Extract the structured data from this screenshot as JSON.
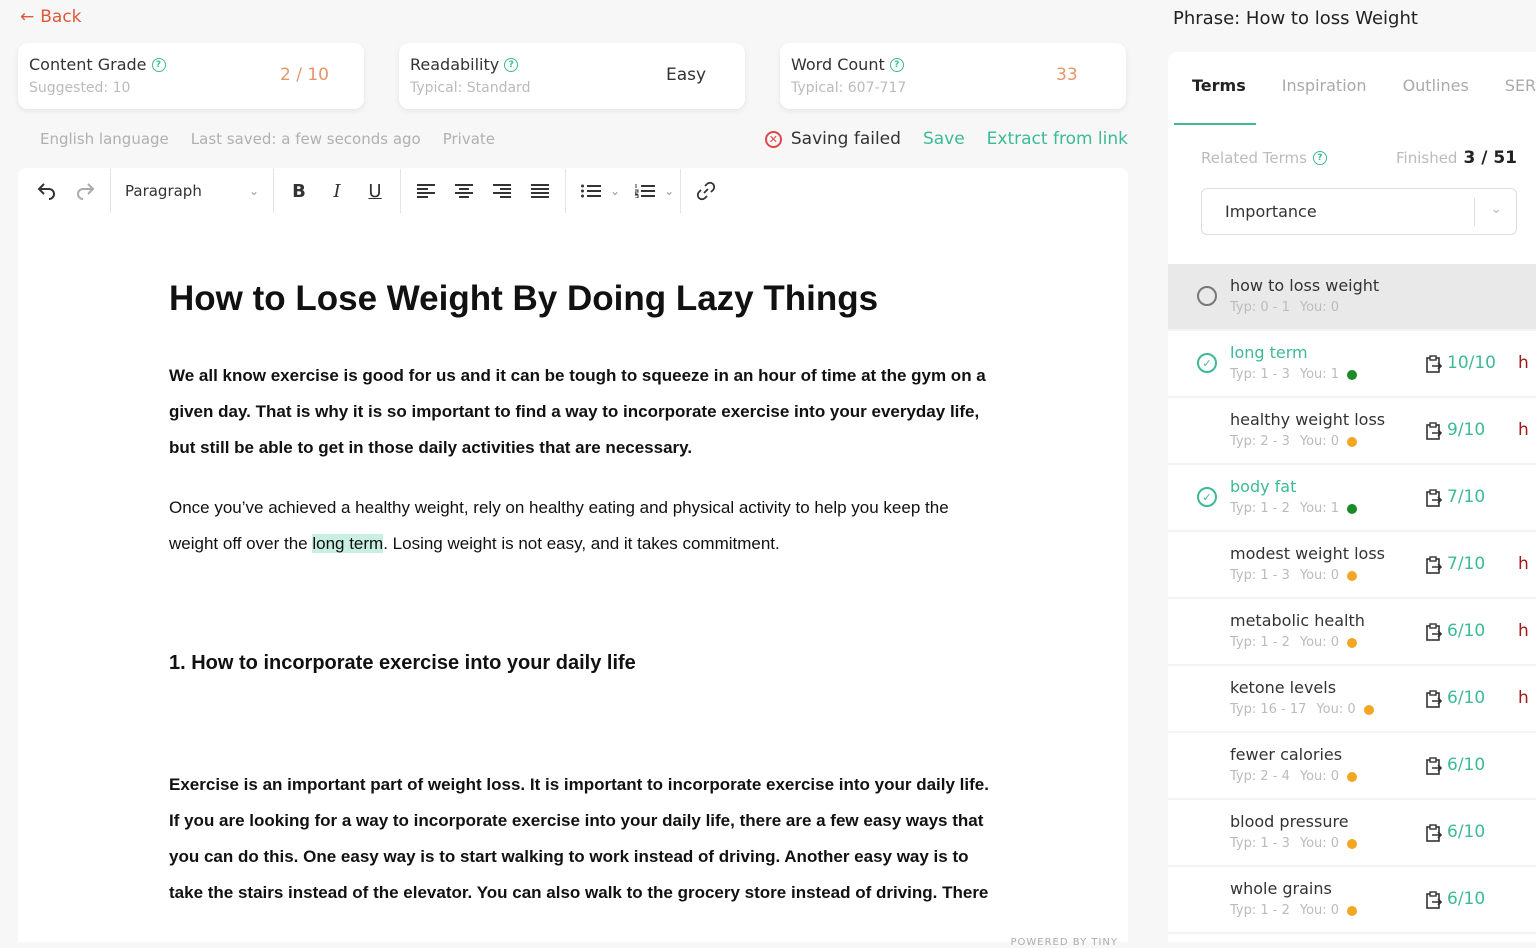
{
  "nav": {
    "back_label": "Back"
  },
  "cards": [
    {
      "title": "Content Grade",
      "sub": "Suggested: 10",
      "value": "2 / 10",
      "value_color": "#e5956a"
    },
    {
      "title": "Readability",
      "sub": "Typical: Standard",
      "value": "Easy",
      "value_color": "#333333"
    },
    {
      "title": "Word Count",
      "sub": "Typical: 607-717",
      "value": "33",
      "value_color": "#e5956a"
    }
  ],
  "meta": {
    "language": "English language",
    "last_saved": "Last saved: a few seconds ago",
    "visibility": "Private"
  },
  "save_status": {
    "status": "Saving failed",
    "save_label": "Save",
    "extract_label": "Extract from link"
  },
  "toolbar": {
    "block_format": "Paragraph",
    "icons": [
      "undo-icon",
      "redo-icon",
      "bold-icon",
      "italic-icon",
      "underline-icon",
      "align-left-icon",
      "align-center-icon",
      "align-right-icon",
      "align-justify-icon",
      "bullet-list-icon",
      "numbered-list-icon",
      "link-icon"
    ]
  },
  "document": {
    "title": "How to Lose Weight By Doing Lazy Things",
    "p1": "We all know exercise is good for us and it can be tough to squeeze in an hour of time at the gym on a given day. That is why it is so important to find a way to incorporate exercise into your everyday life, but still be able to get in those daily activities that are necessary.",
    "p2_before": "Once you’ve achieved a healthy weight, rely on healthy eating and physical activity to help you keep the weight off over the ",
    "p2_highlight": "long term",
    "p2_after": ". Losing weight is not easy, and it takes commitment.",
    "h2": "1. How to incorporate exercise into your daily life",
    "p3": "Exercise is an important part of weight loss. It is important to incorporate exercise into your daily life. If you are looking for a way to incorporate exercise into your daily life, there are a few easy ways that you can do this. One easy way is to start walking to work instead of driving. Another easy way is to take the stairs instead of the elevator. You can also walk to the grocery store instead of driving. There are many easy ways to incorporate exercise into your",
    "powered_by": "POWERED BY TINY"
  },
  "sidebar": {
    "phrase": "Phrase: How to loss Weight",
    "tabs": [
      "Terms",
      "Inspiration",
      "Outlines",
      "SERP"
    ],
    "active_tab": "Terms",
    "related_label": "Related Terms",
    "finished_label": "Finished",
    "finished_value": "3 / 51",
    "sort_value": "Importance",
    "terms": [
      {
        "name": "how to loss weight",
        "typ": "Typ: 0 - 1",
        "you": "You: 0",
        "status": "empty",
        "dot": "",
        "score": "",
        "h": ""
      },
      {
        "name": "long term",
        "typ": "Typ: 1 - 3",
        "you": "You: 1",
        "status": "done",
        "dot": "#1a8a2a",
        "score": "10/10",
        "h": "h"
      },
      {
        "name": "healthy weight loss",
        "typ": "Typ: 2 - 3",
        "you": "You: 0",
        "status": "none",
        "dot": "#f2a623",
        "score": "9/10",
        "h": "h"
      },
      {
        "name": "body fat",
        "typ": "Typ: 1 - 2",
        "you": "You: 1",
        "status": "done",
        "dot": "#1a8a2a",
        "score": "7/10",
        "h": ""
      },
      {
        "name": "modest weight loss",
        "typ": "Typ: 1 - 3",
        "you": "You: 0",
        "status": "none",
        "dot": "#f2a623",
        "score": "7/10",
        "h": "h"
      },
      {
        "name": "metabolic health",
        "typ": "Typ: 1 - 2",
        "you": "You: 0",
        "status": "none",
        "dot": "#f2a623",
        "score": "6/10",
        "h": "h"
      },
      {
        "name": "ketone levels",
        "typ": "Typ: 16 - 17",
        "you": "You: 0",
        "status": "none",
        "dot": "#f2a623",
        "score": "6/10",
        "h": "h"
      },
      {
        "name": "fewer calories",
        "typ": "Typ: 2 - 4",
        "you": "You: 0",
        "status": "none",
        "dot": "#f2a623",
        "score": "6/10",
        "h": ""
      },
      {
        "name": "blood pressure",
        "typ": "Typ: 1 - 3",
        "you": "You: 0",
        "status": "none",
        "dot": "#f2a623",
        "score": "6/10",
        "h": ""
      },
      {
        "name": "whole grains",
        "typ": "Typ: 1 - 2",
        "you": "You: 0",
        "status": "none",
        "dot": "#f2a623",
        "score": "6/10",
        "h": ""
      }
    ]
  },
  "colors": {
    "accent": "#3dba95",
    "back": "#e0573a",
    "error": "#e04848"
  }
}
